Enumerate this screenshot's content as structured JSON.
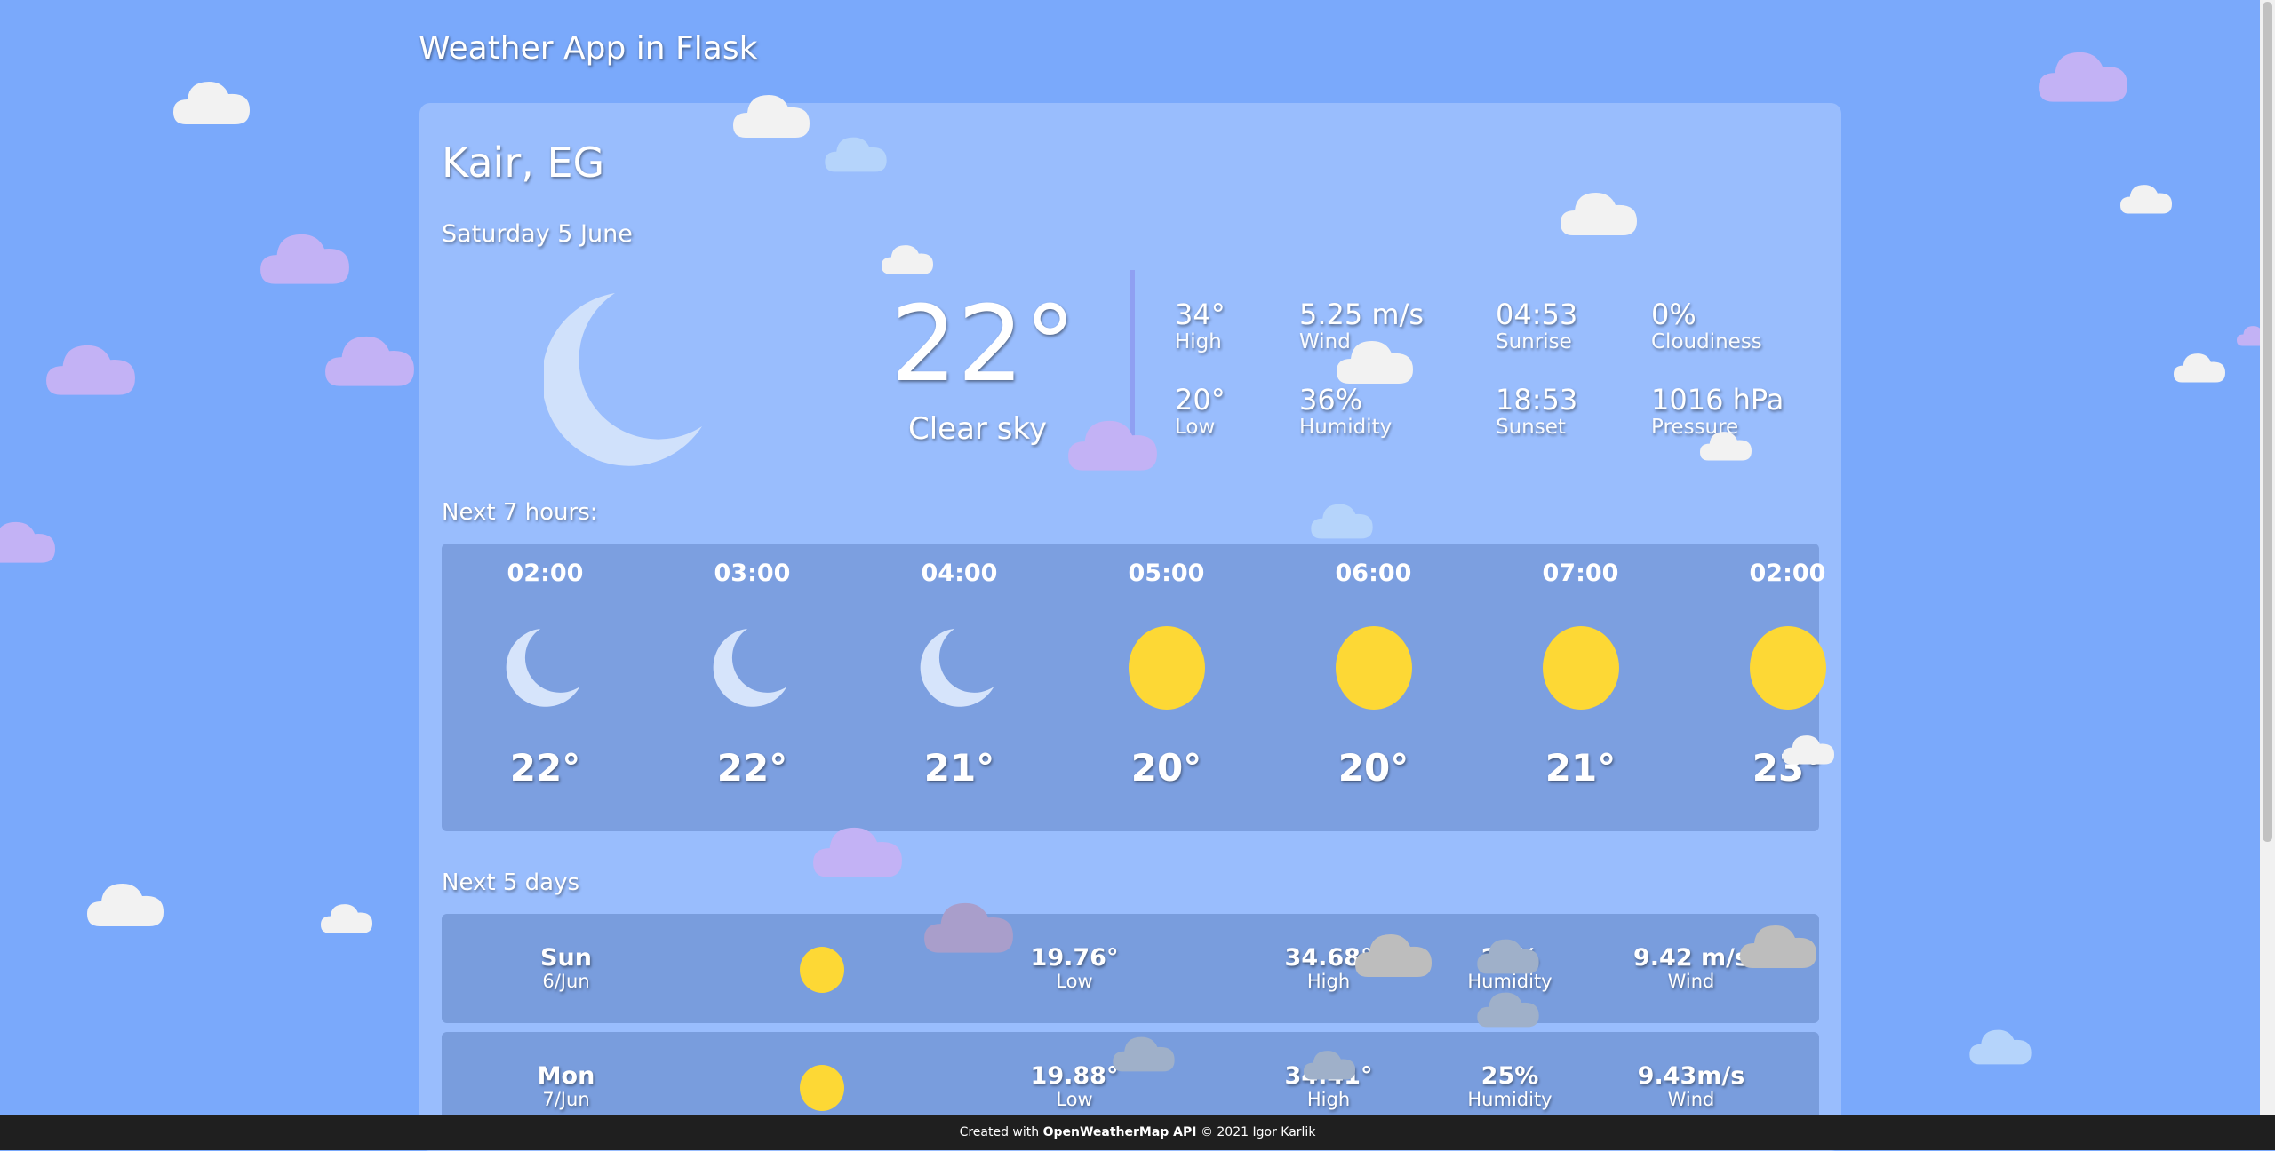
{
  "app": {
    "title": "Weather App in Flask"
  },
  "current": {
    "location": "Kair, EG",
    "date": "Saturday 5 June",
    "temperature": "22°",
    "condition": "Clear sky",
    "icon": "moon-icon",
    "stats": {
      "high": {
        "value": "34°",
        "label": "High"
      },
      "low": {
        "value": "20°",
        "label": "Low"
      },
      "wind": {
        "value": "5.25 m/s",
        "label": "Wind"
      },
      "humidity": {
        "value": "36%",
        "label": "Humidity"
      },
      "sunrise": {
        "value": "04:53",
        "label": "Sunrise"
      },
      "sunset": {
        "value": "18:53",
        "label": "Sunset"
      },
      "cloudiness": {
        "value": "0%",
        "label": "Cloudiness"
      },
      "pressure": {
        "value": "1016 hPa",
        "label": "Pressure"
      }
    }
  },
  "hourly": {
    "heading": "Next 7 hours:",
    "items": [
      {
        "time": "02:00",
        "temp": "22°",
        "icon": "moon-icon"
      },
      {
        "time": "03:00",
        "temp": "22°",
        "icon": "moon-icon"
      },
      {
        "time": "04:00",
        "temp": "21°",
        "icon": "moon-icon"
      },
      {
        "time": "05:00",
        "temp": "20°",
        "icon": "sun-icon"
      },
      {
        "time": "06:00",
        "temp": "20°",
        "icon": "sun-icon"
      },
      {
        "time": "07:00",
        "temp": "21°",
        "icon": "sun-icon"
      },
      {
        "time": "02:00",
        "temp": "23°",
        "icon": "sun-icon"
      }
    ]
  },
  "daily": {
    "heading": "Next 5 days",
    "items": [
      {
        "day": "Sun",
        "date": "6/Jun",
        "icon": "sun-icon",
        "low": "19.76°",
        "low_label": "Low",
        "high": "34.68°",
        "high_label": "High",
        "humidity": "29%",
        "humidity_label": "Humidity",
        "wind": "9.42 m/s",
        "wind_label": "Wind"
      },
      {
        "day": "Mon",
        "date": "7/Jun",
        "icon": "sun-icon",
        "low": "19.88°",
        "low_label": "Low",
        "high": "34.41°",
        "high_label": "High",
        "humidity": "25%",
        "humidity_label": "Humidity",
        "wind": "9.43m/s",
        "wind_label": "Wind"
      }
    ]
  },
  "footer": {
    "prefix": "Created with",
    "api": "OpenWeatherMap API",
    "suffix": "© 2021 Igor Karlik"
  },
  "colors": {
    "background": "#7aa9fb",
    "sun": "#fdd835",
    "moon": "#d6e4fb",
    "footer": "#1f1f1f"
  }
}
